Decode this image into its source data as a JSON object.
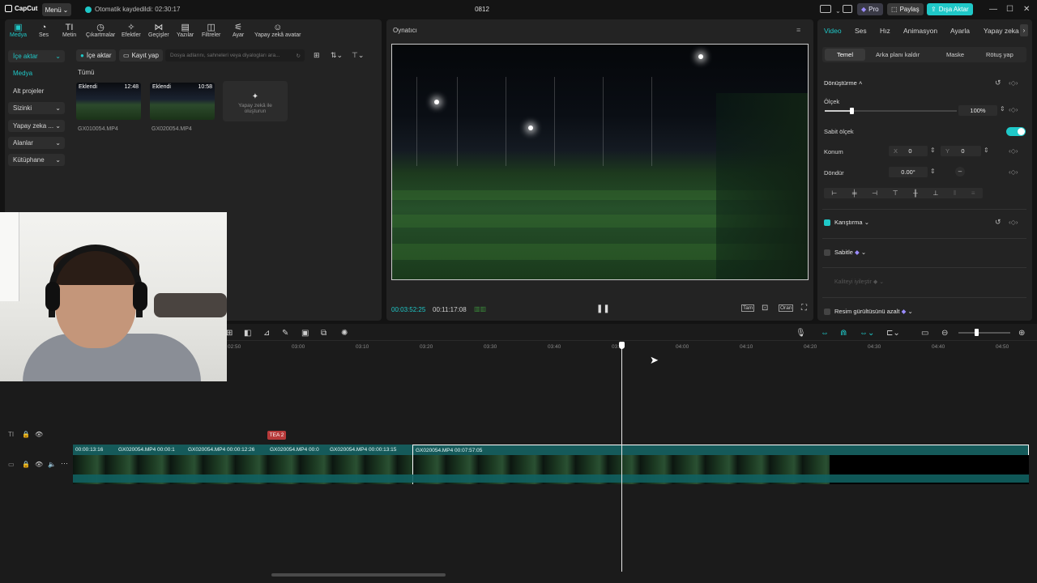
{
  "titlebar": {
    "app_name": "CapCut",
    "menu_label": "Menü",
    "autosave": "Otomatik kaydedildi: 02:30:17",
    "project_name": "0812",
    "pro_label": "Pro",
    "share_label": "Paylaş",
    "export_label": "Dışa Aktar"
  },
  "toolbar": {
    "items": [
      {
        "label": "Medya",
        "icon": "media-icon"
      },
      {
        "label": "Ses",
        "icon": "audio-icon"
      },
      {
        "label": "Metin",
        "icon": "text-icon"
      },
      {
        "label": "Çıkartmalar",
        "icon": "sticker-icon"
      },
      {
        "label": "Efektler",
        "icon": "effects-icon"
      },
      {
        "label": "Geçişler",
        "icon": "transitions-icon"
      },
      {
        "label": "Yazılar",
        "icon": "captions-icon"
      },
      {
        "label": "Filtreler",
        "icon": "filters-icon"
      },
      {
        "label": "Ayar",
        "icon": "adjust-icon"
      },
      {
        "label": "Yapay zekâ avatar",
        "icon": "ai-avatar-icon"
      }
    ]
  },
  "sidebar": {
    "items": [
      {
        "label": "İçe aktar"
      },
      {
        "label": "Medya"
      },
      {
        "label": "Alt projeler"
      },
      {
        "label": "Sizinki"
      },
      {
        "label": "Yapay zeka ..."
      },
      {
        "label": "Alanlar"
      },
      {
        "label": "Kütüphane"
      }
    ]
  },
  "media": {
    "import_label": "İçe aktar",
    "record_label": "Kayıt yap",
    "search_placeholder": "Dosya adlarını, sahneleri veya diyalogları ara...",
    "filter_all": "Tümü",
    "clips": [
      {
        "tag": "Eklendi",
        "duration": "12:48",
        "name": "GX010054.MP4"
      },
      {
        "tag": "Eklendi",
        "duration": "10:58",
        "name": "GX020054.MP4"
      }
    ],
    "ai_create": "Yapay zekâ ile oluşturun"
  },
  "player": {
    "title": "Oynatıcı",
    "current_time": "00:03:52:25",
    "total_time": "00:11:17:08",
    "full_label": "Tam",
    "ratio_label": "Oran"
  },
  "inspector": {
    "tabs": [
      "Video",
      "Ses",
      "Hız",
      "Animasyon",
      "Ayarla",
      "Yapay zeka"
    ],
    "subtabs": [
      "Temel",
      "Arka planı kaldır",
      "Maske",
      "Rötuş yap"
    ],
    "transform_label": "Dönüştürme",
    "scale_label": "Ölçek",
    "scale_value": "100%",
    "scale_fraction": 1.0,
    "uniform_scale_label": "Sabit ölçek",
    "position_label": "Konum",
    "pos_x_label": "X",
    "pos_x": "0",
    "pos_y_label": "Y",
    "pos_y": "0",
    "rotate_label": "Döndür",
    "rotate_value": "0.00°",
    "blend_label": "Karıştırma",
    "stabilize_label": "Sabitle",
    "quality_label": "Kaliteyi iyileştir",
    "denoise_label": "Resim gürültüsünü azalt"
  },
  "timeline": {
    "ruler": [
      "02:50",
      "03:00",
      "03:10",
      "03:20",
      "03:30",
      "03:40",
      "03:50",
      "04:00",
      "04:10",
      "04:20",
      "04:30",
      "04:40",
      "04:50"
    ],
    "text_clip_label": "TEA 2",
    "clips": [
      {
        "label": "00:00:13:16"
      },
      {
        "label": "GX020054.MP4  00:00:1"
      },
      {
        "label": "GX020054.MP4  00:00:12:26"
      },
      {
        "label": "GX020054.MP4  00:0"
      },
      {
        "label": "GX020054.MP4  00:00:13:15"
      },
      {
        "label": "GX020054.MP4  00:07:57:05"
      }
    ]
  },
  "colors": {
    "accent": "#1fc8c8",
    "panel": "#232323",
    "background": "#131313"
  }
}
